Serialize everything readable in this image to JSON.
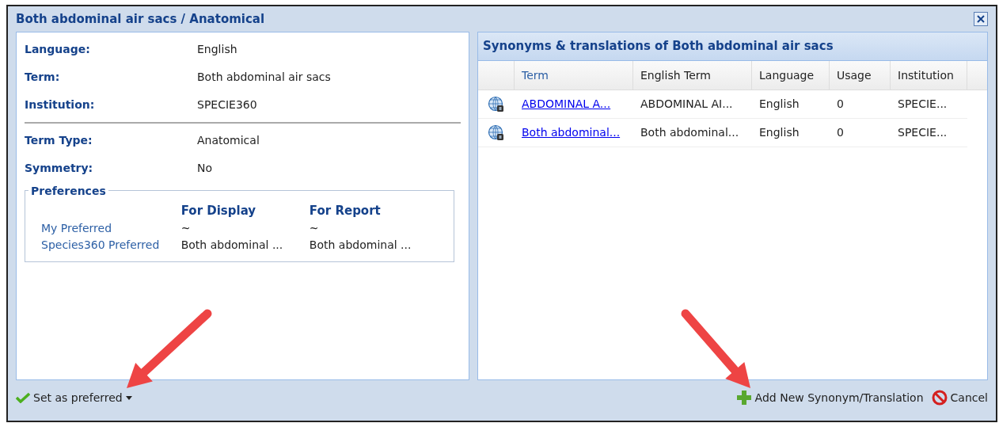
{
  "window": {
    "title": "Both abdominal air sacs / Anatomical"
  },
  "details": [
    {
      "label": "Language:",
      "value": "English"
    },
    {
      "label": "Term:",
      "value": "Both abdominal air sacs"
    },
    {
      "label": "Institution:",
      "value": "SPECIE360"
    }
  ],
  "details_2": [
    {
      "label": "Term Type:",
      "value": "Anatomical"
    },
    {
      "label": "Symmetry:",
      "value": "No"
    }
  ],
  "preferences": {
    "legend": "Preferences",
    "columns": [
      "For Display",
      "For Report"
    ],
    "rows": [
      {
        "label": "My Preferred",
        "values": [
          "~",
          "~"
        ]
      },
      {
        "label": "Species360 Preferred",
        "values": [
          "Both abdominal ...",
          "Both abdominal ..."
        ]
      }
    ]
  },
  "synonyms": {
    "title": "Synonyms & translations of Both abdominal air sacs",
    "columns": [
      {
        "label": "Term",
        "sorted": true
      },
      {
        "label": "English Term",
        "sorted": false
      },
      {
        "label": "Language",
        "sorted": false
      },
      {
        "label": "Usage",
        "sorted": false
      },
      {
        "label": "Institution",
        "sorted": false
      }
    ],
    "rows": [
      {
        "cells": [
          "ABDOMINAL A...",
          "ABDOMINAL AI...",
          "English",
          "0",
          "SPECIE..."
        ]
      },
      {
        "cells": [
          "Both abdominal...",
          "Both abdominal...",
          "English",
          "0",
          "SPECIE..."
        ]
      }
    ]
  },
  "footer": {
    "set_preferred": "Set as preferred",
    "add": "Add New Synonym/Translation",
    "cancel": "Cancel"
  }
}
